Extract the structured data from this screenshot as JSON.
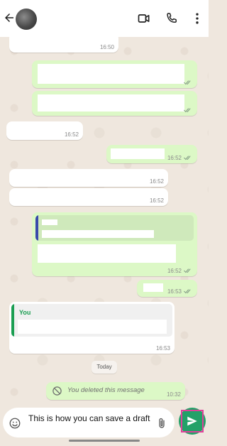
{
  "header": {
    "back_icon": "arrow-left-icon",
    "video_icon": "video-call-icon",
    "call_icon": "phone-icon",
    "menu_icon": "more-vertical-icon"
  },
  "messages": {
    "m1_time": "16:50",
    "m2_time": "",
    "m3_time": "",
    "m4_time": "16:52",
    "m5_time": "16:52",
    "m6_time": "16:52",
    "m7_time": "16:52",
    "m8_time": "16:52",
    "m9_time": "16:53",
    "m10_you": "You",
    "m10_time": "16:53"
  },
  "date_separator": "Today",
  "deleted": {
    "text": "You deleted this message",
    "time": "10:32"
  },
  "composer": {
    "draft": "This is how you can save a draft",
    "emoji_icon": "emoji-icon",
    "attach_icon": "paperclip-icon",
    "send_icon": "send-icon"
  },
  "colors": {
    "accent": "#23a168",
    "outgoing_bubble": "#dcf8c6",
    "incoming_bubble": "#ffffff",
    "chat_background": "#efe7de",
    "tick_read": "#4fc3f7",
    "tick_grey": "#8aa28a",
    "quote_bar_outgoing": "#3949ab",
    "quote_bar_you": "#1b9e52",
    "highlight_border": "#e0409a"
  }
}
